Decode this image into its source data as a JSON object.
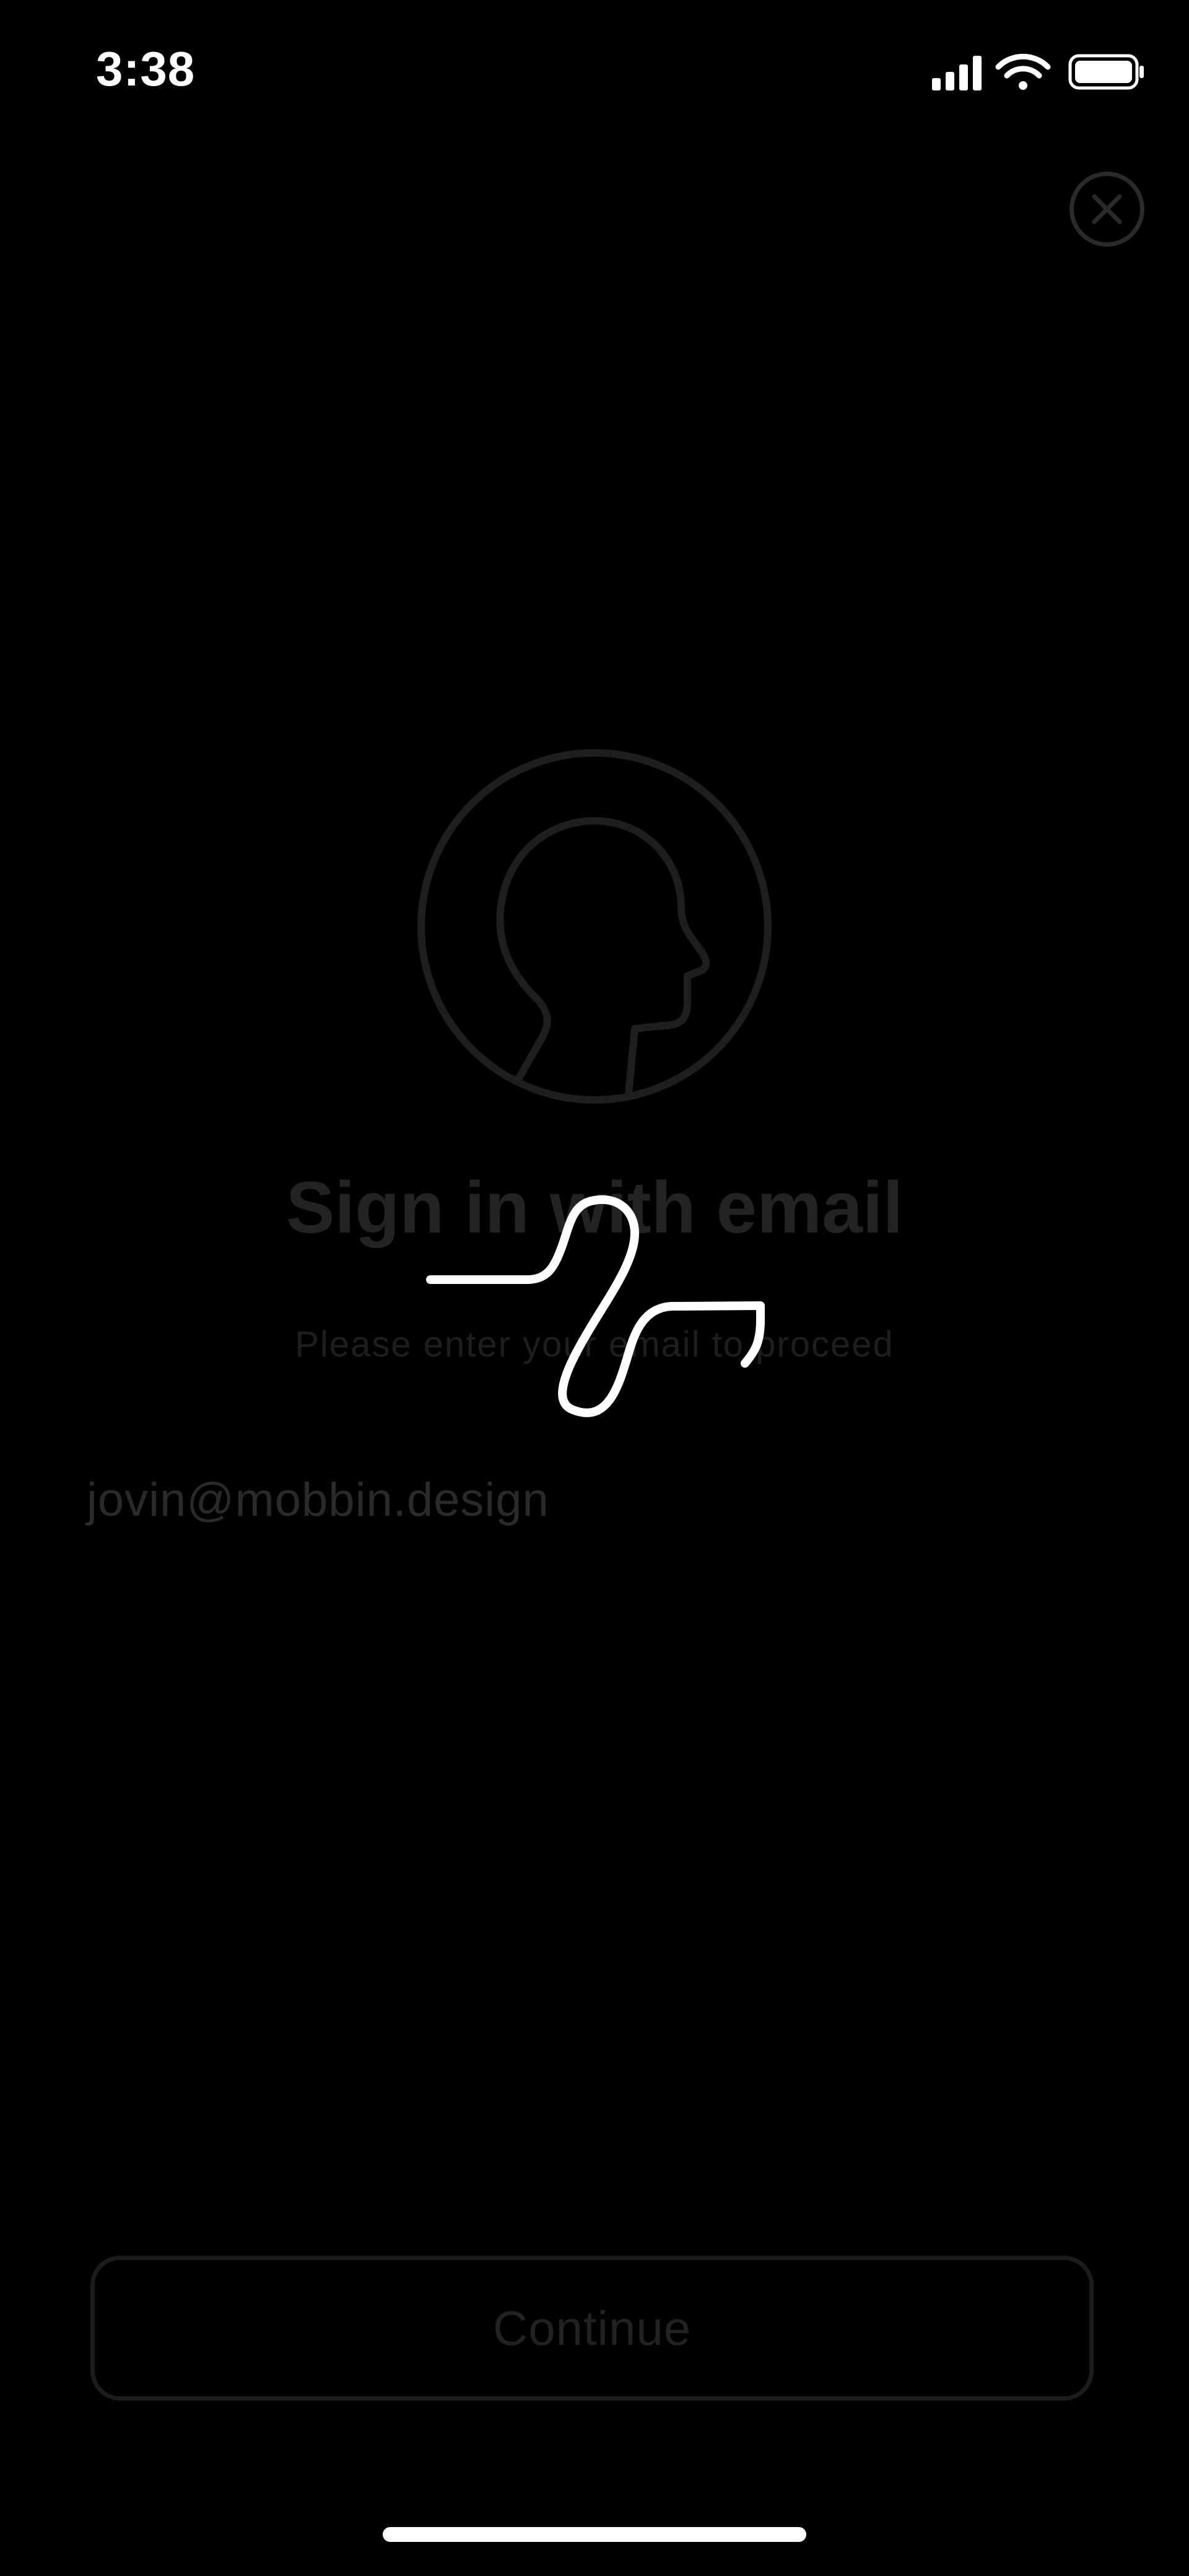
{
  "status_bar": {
    "time": "3:38",
    "icons": [
      "signal-icon",
      "wifi-icon",
      "battery-icon"
    ]
  },
  "close_button": {
    "icon": "close-icon"
  },
  "avatar": {
    "icon": "person-profile-icon"
  },
  "sign_in": {
    "title": "Sign in with email",
    "subtitle": "Please enter your email to proceed",
    "email_value": "jovin@mobbin.design"
  },
  "footer": {
    "continue_label": "Continue"
  },
  "loader": {
    "icon": "loading-spinner-icon"
  },
  "colors": {
    "background": "#000000",
    "foreground": "#ffffff",
    "dimmed_text": "#232323",
    "dimmed_stroke": "#1c1c1c"
  }
}
